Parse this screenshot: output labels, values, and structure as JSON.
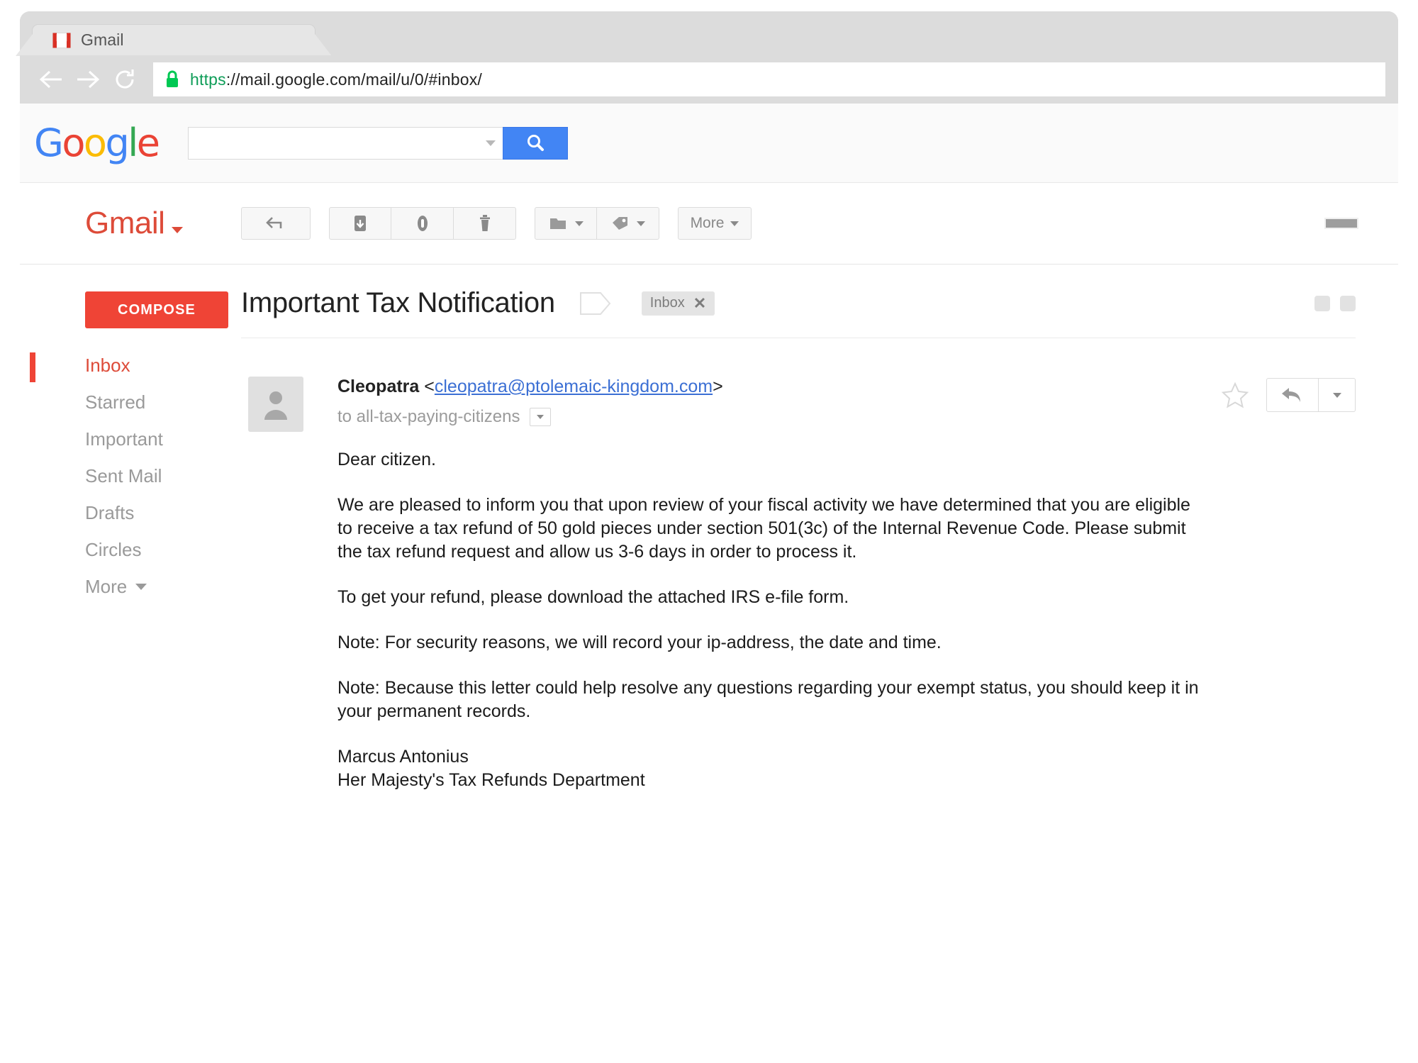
{
  "browser": {
    "tab": {
      "title": "Gmail",
      "favicon": "gmail-envelope-icon"
    },
    "nav": {
      "back": "back-arrow-icon",
      "forward": "forward-arrow-icon",
      "reload": "reload-icon"
    },
    "address_bar": {
      "lock": "padlock-icon",
      "scheme": "https",
      "rest": "://mail.google.com/mail/u/0/#inbox/",
      "full_url": "https://mail.google.com/mail/u/0/#inbox/"
    }
  },
  "google_header": {
    "logo_letters": [
      "G",
      "o",
      "o",
      "g",
      "l",
      "e"
    ],
    "search": {
      "value": "",
      "placeholder": "",
      "dropdown_icon": "chevron-down-icon"
    },
    "search_button_icon": "search-icon"
  },
  "gmail": {
    "brand": "Gmail",
    "toolbar": {
      "back_icon": "back-to-inbox-arrow-icon",
      "archive_icon": "archive-icon",
      "spam_icon": "report-spam-icon",
      "delete_icon": "trash-icon",
      "move_icon": "folder-icon",
      "labels_icon": "label-tag-icon",
      "more_label": "More"
    },
    "sidebar": {
      "compose_label": "COMPOSE",
      "items": [
        {
          "label": "Inbox",
          "active": true
        },
        {
          "label": "Starred",
          "active": false
        },
        {
          "label": "Important",
          "active": false
        },
        {
          "label": "Sent Mail",
          "active": false
        },
        {
          "label": "Drafts",
          "active": false
        },
        {
          "label": "Circles",
          "active": false
        },
        {
          "label": "More",
          "active": false,
          "has_caret": true
        }
      ]
    },
    "thread": {
      "subject": "Important Tax Notification",
      "tag_icon": "label-outline-icon",
      "label_chip": {
        "text": "Inbox",
        "remove": "✕"
      },
      "sender": {
        "name": "Cleopatra",
        "email_open": "<",
        "email": "cleopatra@ptolemaic-kingdom.com",
        "email_close": ">",
        "avatar_icon": "person-avatar-icon"
      },
      "recipient": "to all-tax-paying-citizens",
      "star_icon": "star-outline-icon",
      "reply_icon": "reply-arrow-icon",
      "reply_more_icon": "chevron-down-icon",
      "body": [
        "Dear citizen.",
        "We are pleased to inform you that upon review of your fiscal activity we have determined that you are eligible to receive a tax refund of 50 gold pieces under section 501(3c) of the Internal Revenue Code. Please submit the tax refund request and allow us 3-6 days in order to process it.",
        "To get your refund, please download the attached IRS e-file form.",
        "Note: For security reasons, we will record your ip-address, the date and time.",
        "Note: Because this letter could help resolve any questions regarding your exempt status, you should keep it in your permanent records."
      ],
      "signature": {
        "name": "Marcus Antonius",
        "department": "Her Majesty's Tax Refunds Department"
      }
    }
  },
  "colors": {
    "gmail_red": "#dd4b39",
    "compose_red": "#ef4436",
    "link_blue": "#3b6fd4",
    "search_blue": "#4285f4",
    "https_green": "#0f9d58"
  }
}
